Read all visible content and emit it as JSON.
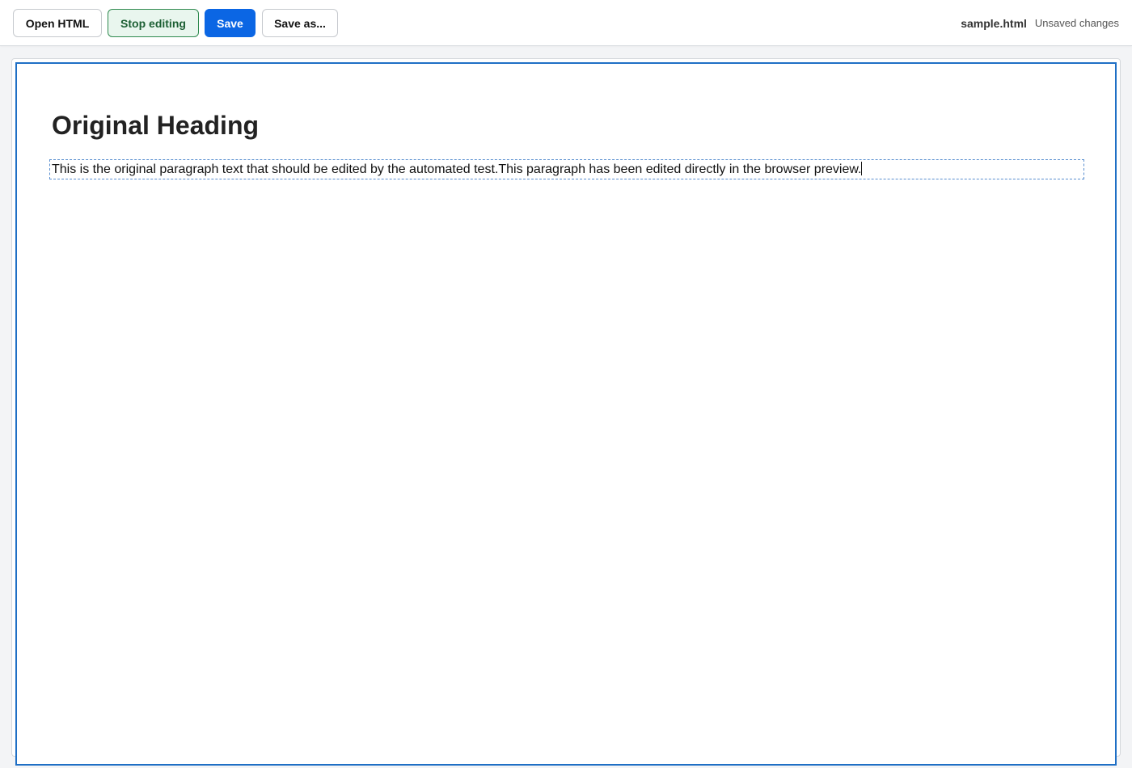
{
  "toolbar": {
    "open_label": "Open HTML",
    "stop_label": "Stop editing",
    "save_label": "Save",
    "saveas_label": "Save as..."
  },
  "file": {
    "name": "sample.html",
    "status": "Unsaved changes"
  },
  "document": {
    "heading": "Original Heading",
    "paragraph": "This is the original paragraph text that should be edited by the automated test.This paragraph has been edited directly in the browser preview."
  },
  "colors": {
    "primary": "#0b66e4",
    "editing_green": "#2f8a4f",
    "frame_blue": "#1f6fc5"
  }
}
